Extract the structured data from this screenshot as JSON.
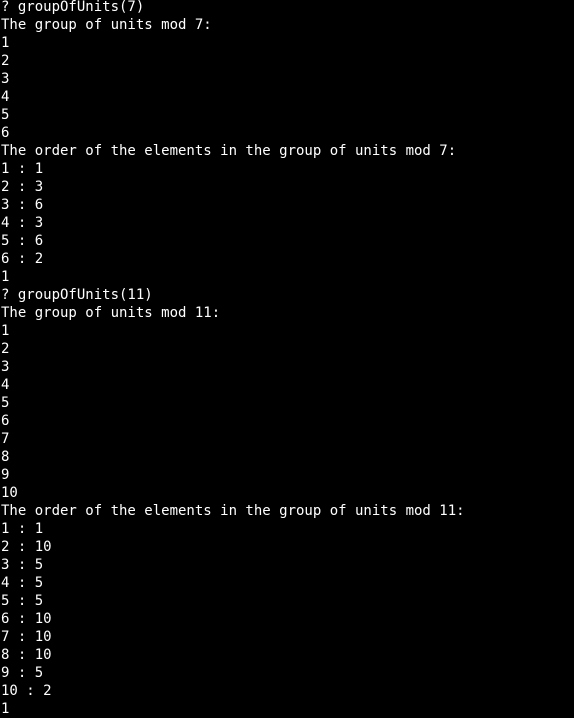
{
  "terminal": {
    "lines": [
      "? groupOfUnits(7)",
      "The group of units mod 7:",
      "1",
      "2",
      "3",
      "4",
      "5",
      "6",
      "The order of the elements in the group of units mod 7:",
      "1 : 1",
      "2 : 3",
      "3 : 6",
      "4 : 3",
      "5 : 6",
      "6 : 2",
      "1",
      "? groupOfUnits(11)",
      "The group of units mod 11:",
      "1",
      "2",
      "3",
      "4",
      "5",
      "6",
      "7",
      "8",
      "9",
      "10",
      "The order of the elements in the group of units mod 11:",
      "1 : 1",
      "2 : 10",
      "3 : 5",
      "4 : 5",
      "5 : 5",
      "6 : 10",
      "7 : 10",
      "8 : 10",
      "9 : 5",
      "10 : 2",
      "1"
    ]
  }
}
